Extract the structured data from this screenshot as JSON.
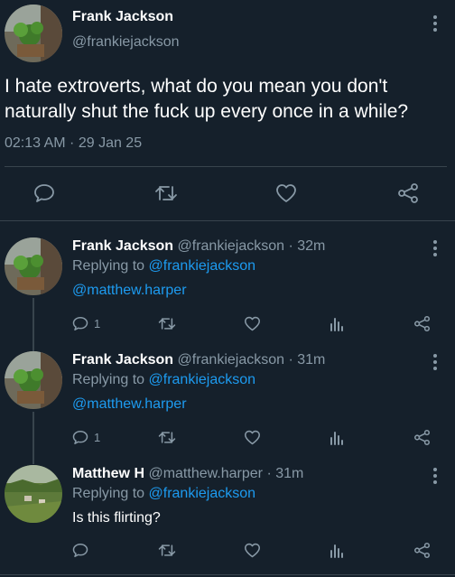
{
  "main": {
    "name": "Frank Jackson",
    "handle": "@frankiejackson",
    "text": "I hate extroverts, what do you mean you don't naturally shut the fuck up every once in a while?",
    "time": "02:13 AM · 29 Jan 25"
  },
  "replies": [
    {
      "name": "Frank Jackson",
      "handle": "@frankiejackson",
      "age": "· 32m",
      "replying_prefix": "Replying to",
      "replying_to": "@frankiejackson",
      "body": "@matthew.harper",
      "reply_count": "1"
    },
    {
      "name": "Frank Jackson",
      "handle": "@frankiejackson",
      "age": "· 31m",
      "replying_prefix": "Replying to",
      "replying_to": "@frankiejackson",
      "body": "@matthew.harper",
      "reply_count": "1"
    },
    {
      "name": "Matthew H",
      "handle": "@matthew.harper",
      "age": "· 31m",
      "replying_prefix": "Replying to",
      "replying_to": "@frankiejackson",
      "body": "Is this flirting?",
      "reply_count": ""
    }
  ],
  "colors": {
    "background": "#15202b",
    "muted": "#8899a6",
    "link": "#1d9bf0",
    "divider": "#38444d"
  },
  "icons": [
    "reply-icon",
    "retweet-icon",
    "like-icon",
    "views-icon",
    "share-icon",
    "more-icon"
  ]
}
